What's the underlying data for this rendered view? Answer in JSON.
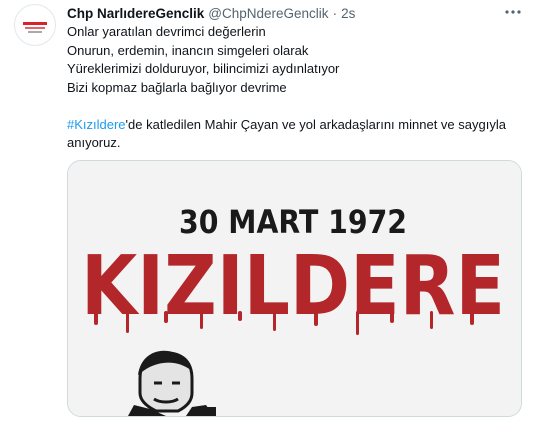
{
  "tweet": {
    "author_name": "Chp NarlıdereGenclik",
    "author_handle": "@ChpNdereGenclik",
    "separator": "·",
    "time": "2s",
    "lines": [
      "Onlar yaratılan devrimci değerlerin",
      "Onurun, erdemin, inancın simgeleri olarak",
      "Yüreklerimizi dolduruyor, bilincimizi aydınlatıyor",
      "Bizi kopmaz bağlarla bağlıyor devrime"
    ],
    "hashtag": "#Kızıldere",
    "after_hashtag": "'de katledilen Mahir Çayan ve yol arkadaşlarını minnet ve saygıyla",
    "last_line": "anıyoruz."
  },
  "media": {
    "date_text": "30 MART 1972",
    "title_text": "KIZILDERE",
    "colors": {
      "background": "#f3f3f3",
      "date": "#1a1a1a",
      "title": "#b3262a"
    }
  },
  "icons": {
    "more": "more-horizontal-icon"
  }
}
